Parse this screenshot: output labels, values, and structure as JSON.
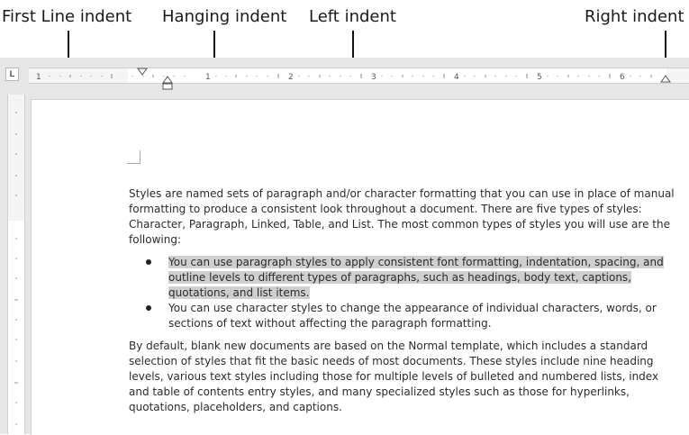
{
  "callouts": {
    "first_line_indent": "First Line indent",
    "hanging_indent": "Hanging indent",
    "left_indent": "Left indent",
    "right_indent": "Right indent"
  },
  "ruler": {
    "tab_selector_glyph": "L",
    "numbers": [
      "1",
      "1",
      "2",
      "3",
      "4",
      "5",
      "6"
    ]
  },
  "document": {
    "paragraph1": "Styles are named sets of paragraph and/or character formatting that you can use in place of manual formatting to produce a consistent look throughout a document. There are five types of styles: Character, Paragraph, Linked, Table, and List. The most common types of styles you will use are the following:",
    "bullets": [
      {
        "text": "You can use paragraph styles to apply consistent font formatting, indentation, spacing, and outline levels to different types of paragraphs, such as headings, body text, captions, quotations, and list items.",
        "highlighted": true
      },
      {
        "text": "You can use character styles to change the appearance of individual characters, words, or sections of text without affecting the paragraph formatting.",
        "highlighted": false
      }
    ],
    "paragraph2": "By default, blank new documents are based on the Normal template, which includes a standard selection of styles that fit the basic needs of most documents. These styles include nine heading levels, various text styles including those for multiple levels of bulleted and numbered lists, index and table of contents entry styles, and many specialized styles such as those for hyperlinks, quotations, placeholders, and captions."
  },
  "colors": {
    "highlight": "#cfcfcf",
    "ruler_bg": "#f4f4f4",
    "frame_bg": "#e6e6e6"
  }
}
